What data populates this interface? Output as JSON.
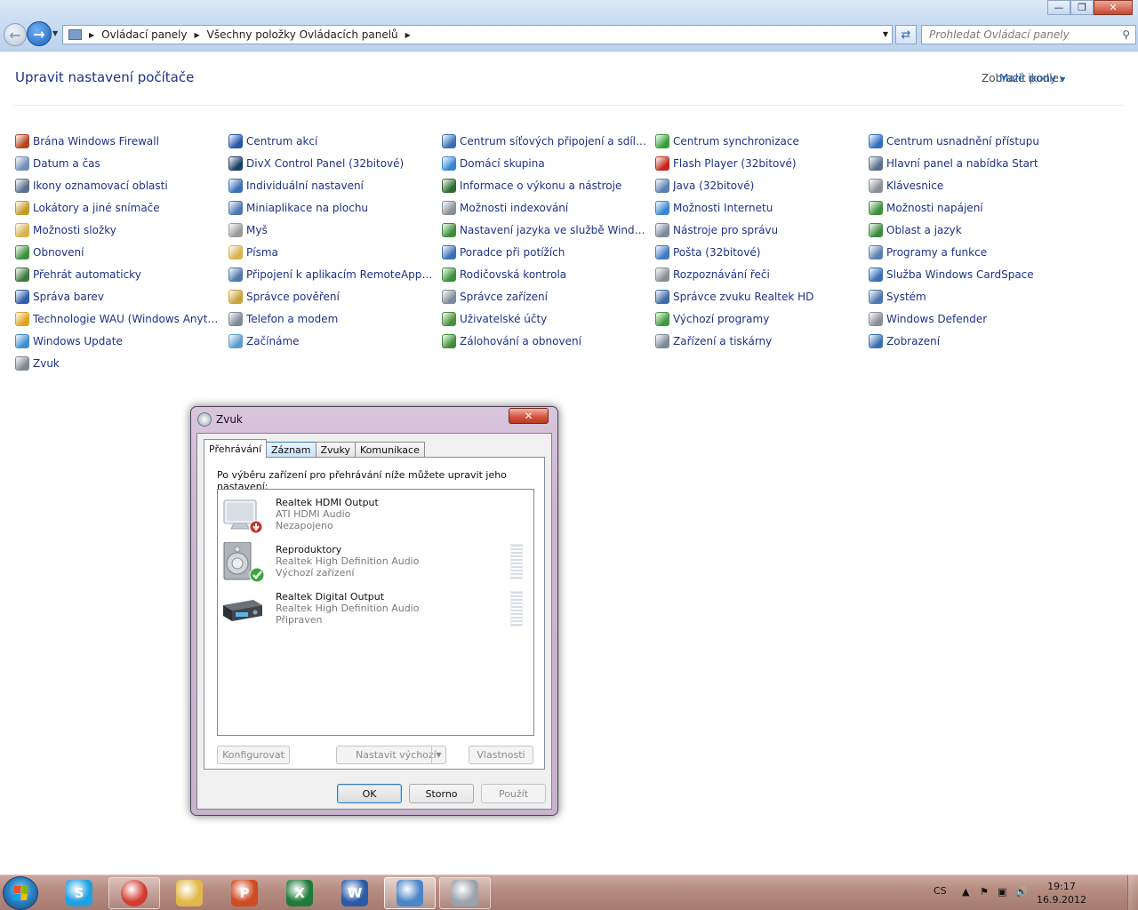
{
  "window": {
    "breadcrumb": [
      "Ovládací panely",
      "Všechny položky Ovládacích panelů"
    ],
    "search_placeholder": "Prohledat Ovládací panely",
    "minimize_glyph": "—",
    "maximize_glyph": "❐",
    "close_glyph": "✕"
  },
  "header": {
    "title": "Upravit nastavení počítače",
    "view_by_label": "Zobrazit podle:",
    "view_mode": "Malé ikony"
  },
  "columns": [
    [
      {
        "label": "Brána Windows Firewall",
        "icon": "firewall-icon",
        "color": "#b5441f"
      },
      {
        "label": "Datum a čas",
        "icon": "clock-icon",
        "color": "#6d8fb8"
      },
      {
        "label": "Ikony oznamovací oblasti",
        "icon": "notification-icon",
        "color": "#5a6f8c"
      },
      {
        "label": "Lokátory a jiné snímače",
        "icon": "sensor-icon",
        "color": "#c59b2a"
      },
      {
        "label": "Možnosti složky",
        "icon": "folder-options-icon",
        "color": "#d8b24a"
      },
      {
        "label": "Obnovení",
        "icon": "recovery-icon",
        "color": "#3e8f3b"
      },
      {
        "label": "Přehrát automaticky",
        "icon": "autoplay-icon",
        "color": "#3d7a3c"
      },
      {
        "label": "Správa barev",
        "icon": "color-management-icon",
        "color": "#2f5ea8"
      },
      {
        "label": "Technologie WAU (Windows Anytim...",
        "icon": "windows-anytime-icon",
        "color": "#e0a321"
      },
      {
        "label": "Windows Update",
        "icon": "windows-update-icon",
        "color": "#3c8ed0"
      },
      {
        "label": "Zvuk",
        "icon": "speaker-icon",
        "color": "#808890"
      }
    ],
    [
      {
        "label": "Centrum akcí",
        "icon": "action-center-flag-icon",
        "color": "#2656a8"
      },
      {
        "label": "DivX Control Panel (32bitové)",
        "icon": "divx-icon",
        "color": "#1d3d66"
      },
      {
        "label": "Individuální nastavení",
        "icon": "personalization-icon",
        "color": "#3a6fb5"
      },
      {
        "label": "Miniaplikace na plochu",
        "icon": "gadgets-icon",
        "color": "#4d77ad"
      },
      {
        "label": "Myš",
        "icon": "mouse-icon",
        "color": "#9a9a9a"
      },
      {
        "label": "Písma",
        "icon": "fonts-icon",
        "color": "#d8b24a"
      },
      {
        "label": "Připojení k aplikacím RemoteApp a v...",
        "icon": "remoteapp-icon",
        "color": "#4d77ad"
      },
      {
        "label": "Správce pověření",
        "icon": "credential-manager-icon",
        "color": "#c7a23a"
      },
      {
        "label": "Telefon a modem",
        "icon": "phone-modem-icon",
        "color": "#7c8a99"
      },
      {
        "label": "Začínáme",
        "icon": "getting-started-icon",
        "color": "#5b9bd0"
      }
    ],
    [
      {
        "label": "Centrum síťových připojení a sdílení",
        "icon": "network-center-icon",
        "color": "#3a6fb5"
      },
      {
        "label": "Domácí skupina",
        "icon": "homegroup-icon",
        "color": "#3586cf"
      },
      {
        "label": "Informace o výkonu a nástroje",
        "icon": "performance-icon",
        "color": "#2e6b2e"
      },
      {
        "label": "Možnosti indexování",
        "icon": "indexing-icon",
        "color": "#8a8f96"
      },
      {
        "label": "Nastavení jazyka ve službě Windows ...",
        "icon": "language-settings-icon",
        "color": "#3d8b3d"
      },
      {
        "label": "Poradce při potížích",
        "icon": "troubleshooting-icon",
        "color": "#3a6fb5"
      },
      {
        "label": "Rodičovská kontrola",
        "icon": "parental-controls-icon",
        "color": "#3e8f3b"
      },
      {
        "label": "Správce zařízení",
        "icon": "device-manager-icon",
        "color": "#7c8a99"
      },
      {
        "label": "Uživatelské účty",
        "icon": "user-accounts-icon",
        "color": "#4d8f3d"
      },
      {
        "label": "Zálohování a obnovení",
        "icon": "backup-icon",
        "color": "#3e8f3b"
      }
    ],
    [
      {
        "label": "Centrum synchronizace",
        "icon": "sync-center-icon",
        "color": "#38a038"
      },
      {
        "label": "Flash Player (32bitové)",
        "icon": "flash-player-icon",
        "color": "#c5261d"
      },
      {
        "label": "Java (32bitové)",
        "icon": "java-icon",
        "color": "#5a7fb0"
      },
      {
        "label": "Možnosti Internetu",
        "icon": "internet-options-icon",
        "color": "#3b86cf"
      },
      {
        "label": "Nástroje pro správu",
        "icon": "admin-tools-icon",
        "color": "#7c8a99"
      },
      {
        "label": "Pošta (32bitové)",
        "icon": "mail-icon",
        "color": "#3e7bc1"
      },
      {
        "label": "Rozpoznávání řeči",
        "icon": "microphone-icon",
        "color": "#8a8f96"
      },
      {
        "label": "Správce zvuku Realtek HD",
        "icon": "realtek-icon",
        "color": "#4169a8"
      },
      {
        "label": "Výchozí programy",
        "icon": "default-programs-icon",
        "color": "#3e9a3e"
      },
      {
        "label": "Zařízení a tiskárny",
        "icon": "printer-icon",
        "color": "#7c8a99"
      }
    ],
    [
      {
        "label": "Centrum usnadnění přístupu",
        "icon": "ease-of-access-icon",
        "color": "#2f6fc0"
      },
      {
        "label": "Hlavní panel a nabídka Start",
        "icon": "taskbar-icon",
        "color": "#5a6f8c"
      },
      {
        "label": "Klávesnice",
        "icon": "keyboard-icon",
        "color": "#8a8f96"
      },
      {
        "label": "Možnosti napájení",
        "icon": "power-options-icon",
        "color": "#3e8f3b"
      },
      {
        "label": "Oblast a jazyk",
        "icon": "region-language-icon",
        "color": "#3d8b3d"
      },
      {
        "label": "Programy a funkce",
        "icon": "programs-icon",
        "color": "#5a7fb0"
      },
      {
        "label": "Služba Windows CardSpace",
        "icon": "cardspace-icon",
        "color": "#3a6fb5"
      },
      {
        "label": "Systém",
        "icon": "system-icon",
        "color": "#4d77ad"
      },
      {
        "label": "Windows Defender",
        "icon": "defender-icon",
        "color": "#8a8f96"
      },
      {
        "label": "Zobrazení",
        "icon": "display-icon",
        "color": "#3a6fb5"
      }
    ]
  ],
  "dialog": {
    "title": "Zvuk",
    "close_glyph": "✕",
    "tabs": [
      "Přehrávání",
      "Záznam",
      "Zvuky",
      "Komunikace"
    ],
    "instruction": "Po výběru zařízení pro přehrávání níže můžete upravit jeho nastavení:",
    "devices": [
      {
        "name": "Realtek HDMI Output",
        "driver": "ATI HDMI Audio",
        "status": "Nezapojeno",
        "icon": "monitor-disconnected-icon"
      },
      {
        "name": "Reproduktory",
        "driver": "Realtek High Definition Audio",
        "status": "Výchozí zařízení",
        "icon": "speakers-default-icon"
      },
      {
        "name": "Realtek Digital Output",
        "driver": "Realtek High Definition Audio",
        "status": "Připraven",
        "icon": "digital-output-icon"
      }
    ],
    "buttons": {
      "configure": "Konfigurovat",
      "set_default": "Nastavit výchozí",
      "properties": "Vlastnosti",
      "ok": "OK",
      "cancel": "Storno",
      "apply": "Použít"
    }
  },
  "taskbar": {
    "apps": [
      {
        "name": "skype-icon",
        "glyph": "S",
        "color": "#1fa0e0"
      },
      {
        "name": "chrome-icon",
        "glyph": "",
        "color": "#d33b2f"
      },
      {
        "name": "explorer-folder-icon",
        "glyph": "",
        "color": "#e2b84a"
      },
      {
        "name": "powerpoint-icon",
        "glyph": "P",
        "color": "#d04a22"
      },
      {
        "name": "excel-icon",
        "glyph": "X",
        "color": "#1f7a3c"
      },
      {
        "name": "word-icon",
        "glyph": "W",
        "color": "#2a5aa8"
      },
      {
        "name": "control-panel-icon",
        "glyph": "",
        "color": "#4b86c8"
      },
      {
        "name": "sound-icon",
        "glyph": "",
        "color": "#9aa3ad"
      }
    ],
    "language": "CS",
    "time": "19:17",
    "date": "16.9.2012"
  }
}
